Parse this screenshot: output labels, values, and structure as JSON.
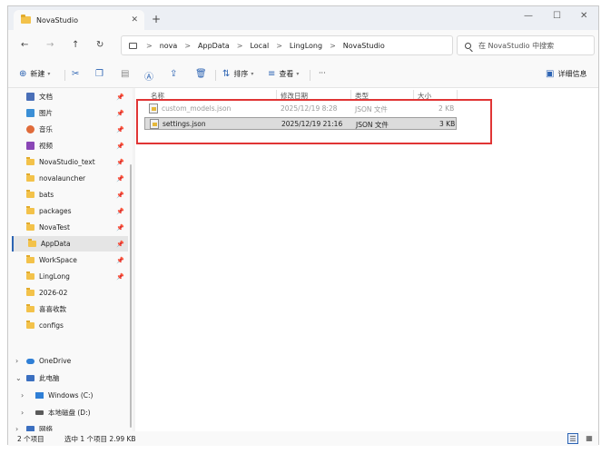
{
  "window": {
    "tab_title": "NovaStudio",
    "tab_close": "✕",
    "new_tab": "+",
    "minimize": "—",
    "maximize": "☐",
    "close": "✕"
  },
  "nav": {
    "back": "←",
    "forward": "→",
    "up": "↑",
    "refresh": "↻"
  },
  "address": {
    "crumbs": [
      "nova",
      "AppData",
      "Local",
      "LingLong",
      "NovaStudio"
    ],
    "separator": ">"
  },
  "search": {
    "placeholder": "在 NovaStudio 中搜索"
  },
  "commands": {
    "new": "新建",
    "sort": "排序",
    "view": "查看",
    "more": "···",
    "details": "详细信息"
  },
  "sidebar": {
    "pinned": [
      {
        "label": "文档",
        "icon": "documents-icon"
      },
      {
        "label": "图片",
        "icon": "pictures-icon"
      },
      {
        "label": "音乐",
        "icon": "music-icon"
      },
      {
        "label": "视频",
        "icon": "videos-icon"
      },
      {
        "label": "NovaStudio_text",
        "icon": "folder-icon"
      },
      {
        "label": "novalauncher",
        "icon": "folder-icon"
      },
      {
        "label": "bats",
        "icon": "folder-icon"
      },
      {
        "label": "packages",
        "icon": "folder-icon"
      },
      {
        "label": "NovaTest",
        "icon": "folder-icon"
      },
      {
        "label": "AppData",
        "icon": "folder-icon"
      },
      {
        "label": "WorkSpace",
        "icon": "folder-icon"
      },
      {
        "label": "LingLong",
        "icon": "folder-icon"
      },
      {
        "label": "2026-02",
        "icon": "folder-icon"
      },
      {
        "label": "喜喜收款",
        "icon": "folder-icon"
      },
      {
        "label": "configs",
        "icon": "folder-icon"
      }
    ],
    "tree": [
      {
        "label": "OneDrive"
      },
      {
        "label": "此电脑"
      },
      {
        "label": "Windows (C:)"
      },
      {
        "label": "本地磁盘 (D:)"
      },
      {
        "label": "网络"
      }
    ]
  },
  "columns": {
    "name": "名称",
    "modified": "修改日期",
    "type": "类型",
    "size": "大小"
  },
  "files": [
    {
      "name": "custom_models.json",
      "modified": "2025/12/19 8:28",
      "type": "JSON 文件",
      "size": "2 KB"
    },
    {
      "name": "settings.json",
      "modified": "2025/12/19 21:16",
      "type": "JSON 文件",
      "size": "3 KB"
    }
  ],
  "status": {
    "count": "2 个项目",
    "selection": "选中 1 个项目  2.99 KB"
  },
  "colors": {
    "accent": "#2d64b3",
    "highlight_box": "#e03535",
    "folder": "#f3c24a"
  }
}
